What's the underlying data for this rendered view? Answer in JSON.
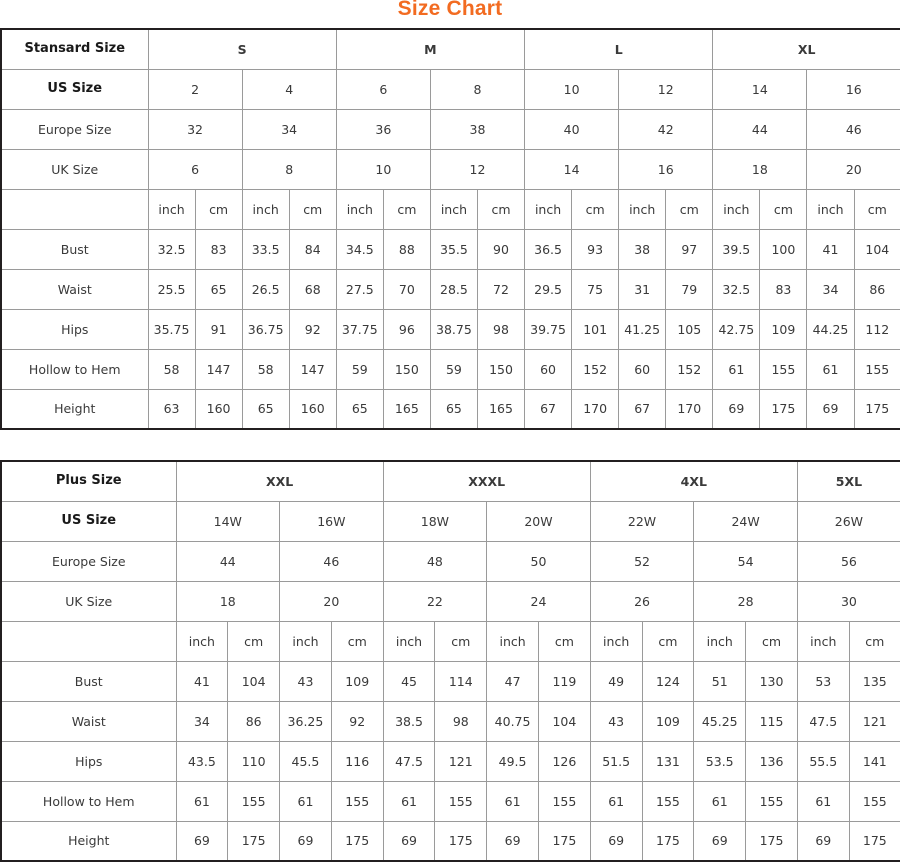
{
  "title": "Size Chart",
  "colors": {
    "title": "#f26b21",
    "outer_border": "#231f20",
    "grid": "#9a9a9a",
    "text": "#3a3a3a"
  },
  "units": {
    "inch": "inch",
    "cm": "cm"
  },
  "standard_table": {
    "corner_label": "Stansard Size",
    "groups": [
      "S",
      "M",
      "L",
      "XL"
    ],
    "rows": [
      {
        "label": "US Size",
        "bold": true,
        "values": [
          "2",
          "4",
          "6",
          "8",
          "10",
          "12",
          "14",
          "16"
        ]
      },
      {
        "label": "Europe Size",
        "bold": false,
        "values": [
          "32",
          "34",
          "36",
          "38",
          "40",
          "42",
          "44",
          "46"
        ]
      },
      {
        "label": "UK Size",
        "bold": false,
        "values": [
          "6",
          "8",
          "10",
          "12",
          "14",
          "16",
          "18",
          "20"
        ]
      }
    ],
    "measurements": [
      {
        "label": "Bust",
        "values": [
          "32.5",
          "83",
          "33.5",
          "84",
          "34.5",
          "88",
          "35.5",
          "90",
          "36.5",
          "93",
          "38",
          "97",
          "39.5",
          "100",
          "41",
          "104"
        ]
      },
      {
        "label": "Waist",
        "values": [
          "25.5",
          "65",
          "26.5",
          "68",
          "27.5",
          "70",
          "28.5",
          "72",
          "29.5",
          "75",
          "31",
          "79",
          "32.5",
          "83",
          "34",
          "86"
        ]
      },
      {
        "label": "Hips",
        "values": [
          "35.75",
          "91",
          "36.75",
          "92",
          "37.75",
          "96",
          "38.75",
          "98",
          "39.75",
          "101",
          "41.25",
          "105",
          "42.75",
          "109",
          "44.25",
          "112"
        ]
      },
      {
        "label": "Hollow to Hem",
        "values": [
          "58",
          "147",
          "58",
          "147",
          "59",
          "150",
          "59",
          "150",
          "60",
          "152",
          "60",
          "152",
          "61",
          "155",
          "61",
          "155"
        ]
      },
      {
        "label": "Height",
        "values": [
          "63",
          "160",
          "65",
          "160",
          "65",
          "165",
          "65",
          "165",
          "67",
          "170",
          "67",
          "170",
          "69",
          "175",
          "69",
          "175"
        ]
      }
    ]
  },
  "plus_table": {
    "corner_label": "Plus Size",
    "groups": [
      {
        "name": "XXL",
        "span": 2
      },
      {
        "name": "XXXL",
        "span": 2
      },
      {
        "name": "4XL",
        "span": 2
      },
      {
        "name": "5XL",
        "span": 1
      }
    ],
    "rows": [
      {
        "label": "US Size",
        "bold": true,
        "values": [
          "14W",
          "16W",
          "18W",
          "20W",
          "22W",
          "24W",
          "26W"
        ]
      },
      {
        "label": "Europe Size",
        "bold": false,
        "values": [
          "44",
          "46",
          "48",
          "50",
          "52",
          "54",
          "56"
        ]
      },
      {
        "label": "UK Size",
        "bold": false,
        "values": [
          "18",
          "20",
          "22",
          "24",
          "26",
          "28",
          "30"
        ]
      }
    ],
    "measurements": [
      {
        "label": "Bust",
        "values": [
          "41",
          "104",
          "43",
          "109",
          "45",
          "114",
          "47",
          "119",
          "49",
          "124",
          "51",
          "130",
          "53",
          "135"
        ]
      },
      {
        "label": "Waist",
        "values": [
          "34",
          "86",
          "36.25",
          "92",
          "38.5",
          "98",
          "40.75",
          "104",
          "43",
          "109",
          "45.25",
          "115",
          "47.5",
          "121"
        ]
      },
      {
        "label": "Hips",
        "values": [
          "43.5",
          "110",
          "45.5",
          "116",
          "47.5",
          "121",
          "49.5",
          "126",
          "51.5",
          "131",
          "53.5",
          "136",
          "55.5",
          "141"
        ]
      },
      {
        "label": "Hollow to Hem",
        "values": [
          "61",
          "155",
          "61",
          "155",
          "61",
          "155",
          "61",
          "155",
          "61",
          "155",
          "61",
          "155",
          "61",
          "155"
        ]
      },
      {
        "label": "Height",
        "values": [
          "69",
          "175",
          "69",
          "175",
          "69",
          "175",
          "69",
          "175",
          "69",
          "175",
          "69",
          "175",
          "69",
          "175"
        ]
      }
    ]
  }
}
